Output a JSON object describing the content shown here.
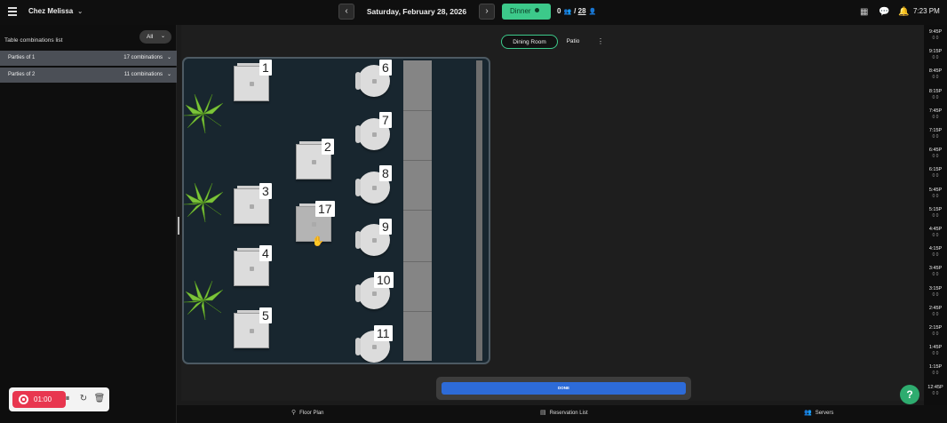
{
  "header": {
    "venue_name": "Chez Melissa",
    "date": "Saturday, February 28, 2026",
    "shift": "Dinner",
    "covers_current": "0",
    "covers_separator": "/",
    "covers_total": "28",
    "time": "7:23 PM",
    "accent_color": "#3cc98a"
  },
  "sidebar": {
    "title": "Table combinations list",
    "filter": "All",
    "parties": [
      {
        "label": "Parties of 1",
        "count": "17 combinations"
      },
      {
        "label": "Parties of 2",
        "count": "11 combinations"
      }
    ]
  },
  "rooms": {
    "tabs": [
      {
        "label": "Dining Room",
        "active": true
      },
      {
        "label": "Patio",
        "active": false
      }
    ]
  },
  "tables": [
    {
      "number": "1",
      "shape": "square"
    },
    {
      "number": "2",
      "shape": "square"
    },
    {
      "number": "3",
      "shape": "square"
    },
    {
      "number": "4",
      "shape": "square"
    },
    {
      "number": "5",
      "shape": "square"
    },
    {
      "number": "17",
      "shape": "square",
      "selected": true
    },
    {
      "number": "6",
      "shape": "round"
    },
    {
      "number": "7",
      "shape": "round"
    },
    {
      "number": "8",
      "shape": "round"
    },
    {
      "number": "9",
      "shape": "round"
    },
    {
      "number": "10",
      "shape": "round"
    },
    {
      "number": "11",
      "shape": "round"
    }
  ],
  "done_label": "DONE",
  "timeline": [
    {
      "time": "9:45P",
      "count": "0 0"
    },
    {
      "time": "9:15P",
      "count": "0 0"
    },
    {
      "time": "8:45P",
      "count": "0 0"
    },
    {
      "time": "8:15P",
      "count": "0 0"
    },
    {
      "time": "7:45P",
      "count": "0 0"
    },
    {
      "time": "7:15P",
      "count": "0 0"
    },
    {
      "time": "6:45P",
      "count": "0 0"
    },
    {
      "time": "6:15P",
      "count": "0 0"
    },
    {
      "time": "5:45P",
      "count": "0 0"
    },
    {
      "time": "5:15P",
      "count": "0 0"
    },
    {
      "time": "4:45P",
      "count": "0 0"
    },
    {
      "time": "4:15P",
      "count": "0 0"
    },
    {
      "time": "3:45P",
      "count": "0 0"
    },
    {
      "time": "3:15P",
      "count": "0 0"
    },
    {
      "time": "2:45P",
      "count": "0 0"
    },
    {
      "time": "2:15P",
      "count": "0 0"
    },
    {
      "time": "1:45P",
      "count": "0 0"
    },
    {
      "time": "1:15P",
      "count": "0 0"
    },
    {
      "time": "12:45P",
      "count": "0 0"
    }
  ],
  "bottom_nav": {
    "floor_plan": "Floor Plan",
    "reservation_list": "Reservation List",
    "servers": "Servers"
  },
  "recorder": {
    "elapsed": "01:00"
  },
  "help_label": "?"
}
